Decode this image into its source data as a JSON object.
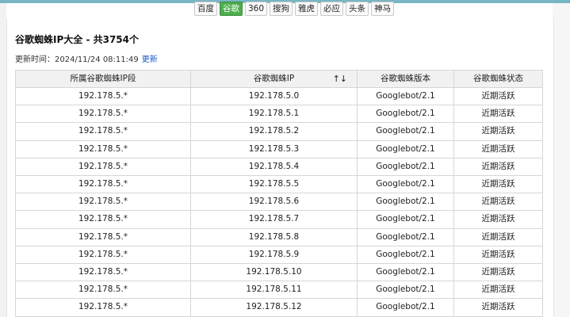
{
  "engine_tabs": [
    {
      "label": "百度",
      "active": false
    },
    {
      "label": "谷歌",
      "active": true
    },
    {
      "label": "360",
      "active": false
    },
    {
      "label": "搜狗",
      "active": false
    },
    {
      "label": "雅虎",
      "active": false
    },
    {
      "label": "必应",
      "active": false
    },
    {
      "label": "头条",
      "active": false
    },
    {
      "label": "神马",
      "active": false
    }
  ],
  "page": {
    "title": "谷歌蜘蛛IP大全 - 共3754个",
    "updated_prefix": "更新时间：",
    "updated_time": "2024/11/24 08:11:49",
    "update_link": "更新"
  },
  "table": {
    "headers": {
      "segment": "所属谷歌蜘蛛IP段",
      "ip": "谷歌蜘蛛IP",
      "sort": "↑↓",
      "version": "谷歌蜘蛛版本",
      "status": "谷歌蜘蛛状态"
    },
    "rows": [
      {
        "segment": "192.178.5.*",
        "ip": "192.178.5.0",
        "version": "Googlebot/2.1",
        "status": "近期活跃"
      },
      {
        "segment": "192.178.5.*",
        "ip": "192.178.5.1",
        "version": "Googlebot/2.1",
        "status": "近期活跃"
      },
      {
        "segment": "192.178.5.*",
        "ip": "192.178.5.2",
        "version": "Googlebot/2.1",
        "status": "近期活跃"
      },
      {
        "segment": "192.178.5.*",
        "ip": "192.178.5.3",
        "version": "Googlebot/2.1",
        "status": "近期活跃"
      },
      {
        "segment": "192.178.5.*",
        "ip": "192.178.5.4",
        "version": "Googlebot/2.1",
        "status": "近期活跃"
      },
      {
        "segment": "192.178.5.*",
        "ip": "192.178.5.5",
        "version": "Googlebot/2.1",
        "status": "近期活跃"
      },
      {
        "segment": "192.178.5.*",
        "ip": "192.178.5.6",
        "version": "Googlebot/2.1",
        "status": "近期活跃"
      },
      {
        "segment": "192.178.5.*",
        "ip": "192.178.5.7",
        "version": "Googlebot/2.1",
        "status": "近期活跃"
      },
      {
        "segment": "192.178.5.*",
        "ip": "192.178.5.8",
        "version": "Googlebot/2.1",
        "status": "近期活跃"
      },
      {
        "segment": "192.178.5.*",
        "ip": "192.178.5.9",
        "version": "Googlebot/2.1",
        "status": "近期活跃"
      },
      {
        "segment": "192.178.5.*",
        "ip": "192.178.5.10",
        "version": "Googlebot/2.1",
        "status": "近期活跃"
      },
      {
        "segment": "192.178.5.*",
        "ip": "192.178.5.11",
        "version": "Googlebot/2.1",
        "status": "近期活跃"
      },
      {
        "segment": "192.178.5.*",
        "ip": "192.178.5.12",
        "version": "Googlebot/2.1",
        "status": "近期活跃"
      }
    ]
  }
}
